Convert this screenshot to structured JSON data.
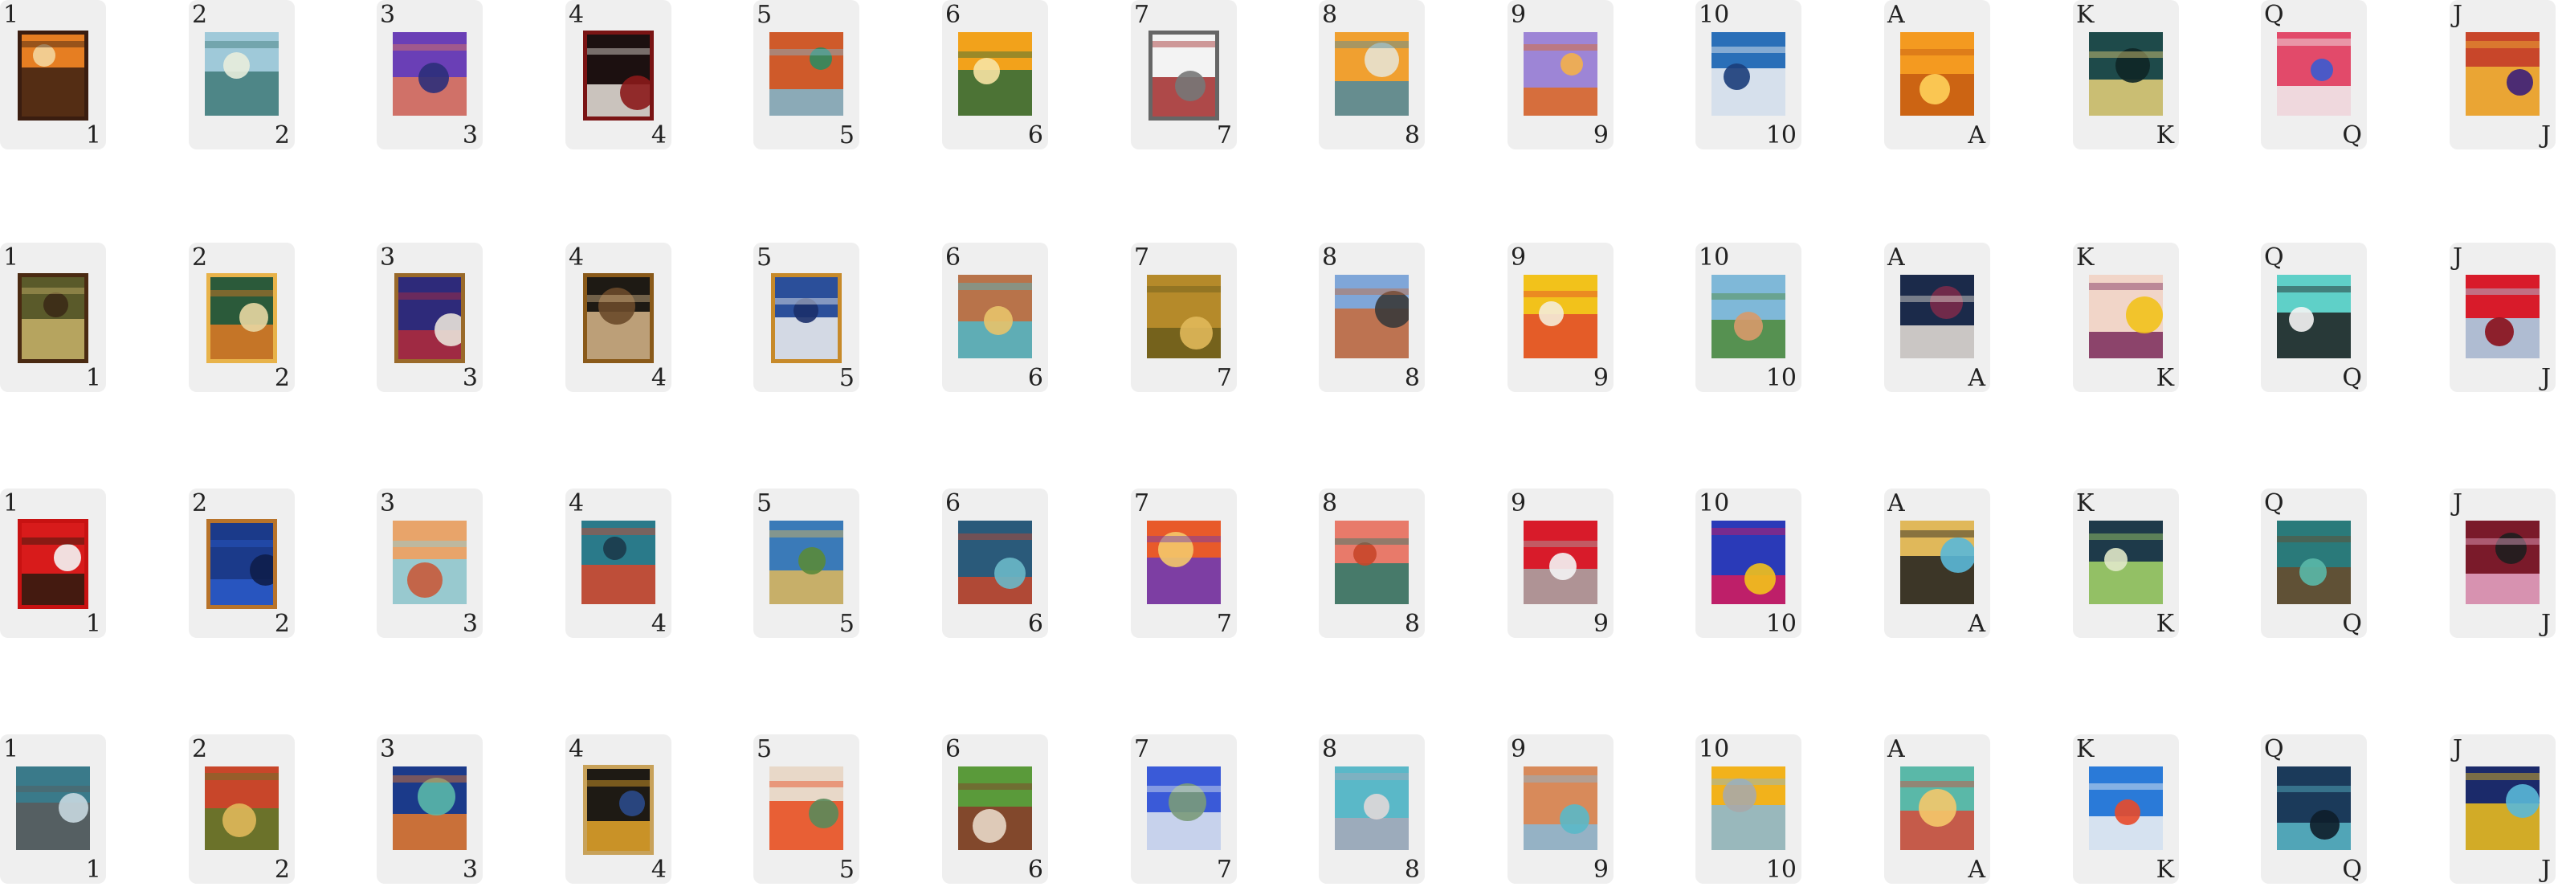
{
  "ranks": [
    "1",
    "2",
    "3",
    "4",
    "5",
    "6",
    "7",
    "8",
    "9",
    "10",
    "A",
    "K",
    "Q",
    "J"
  ],
  "rows": [
    {
      "cards": [
        {
          "art": "woman-portrait-art",
          "palette": [
            "#e67e22",
            "#3a1f12",
            "#f3d59c"
          ],
          "frame": "#3a1d10"
        },
        {
          "art": "coastal-landscape-art",
          "palette": [
            "#9fc9d9",
            "#3f7a78",
            "#e8eddc"
          ],
          "frame": ""
        },
        {
          "art": "reclining-figure-art",
          "palette": [
            "#6a3fb6",
            "#e27a5a",
            "#2c2f7a"
          ],
          "frame": ""
        },
        {
          "art": "ruffled-collar-portrait-art",
          "palette": [
            "#1c1010",
            "#e9e3dc",
            "#8b1a1a"
          ],
          "frame": "#7a1414"
        },
        {
          "art": "red-mesa-landscape-art",
          "palette": [
            "#cf5a2a",
            "#7fb8d0",
            "#2f8a5f"
          ],
          "frame": ""
        },
        {
          "art": "waterfall-poster-art",
          "palette": [
            "#f2a21b",
            "#2f6b3a",
            "#f7e3a3"
          ],
          "frame": ""
        },
        {
          "art": "city-sketch-art",
          "palette": [
            "#f3f3f3",
            "#a12a2a",
            "#777777"
          ],
          "frame": "#666666"
        },
        {
          "art": "canyon-cliffs-art",
          "palette": [
            "#f0a030",
            "#4e8aa0",
            "#e7e2d2"
          ],
          "frame": ""
        },
        {
          "art": "stone-arch-art",
          "palette": [
            "#9d85d6",
            "#e06a22",
            "#f4b04a"
          ],
          "frame": ""
        },
        {
          "art": "astronaut-wave-art",
          "palette": [
            "#2a6fb8",
            "#f4f4f4",
            "#1b3d7a"
          ],
          "frame": ""
        },
        {
          "art": "orange-sunset-art",
          "palette": [
            "#f49a20",
            "#c45a12",
            "#ffd05a"
          ],
          "frame": ""
        },
        {
          "art": "night-pond-art",
          "palette": [
            "#1e4a4a",
            "#e9d27a",
            "#0e2626"
          ],
          "frame": ""
        },
        {
          "art": "abstract-swirl-art",
          "palette": [
            "#e24a6a",
            "#f1f1f1",
            "#3b5bd0"
          ],
          "frame": ""
        },
        {
          "art": "desert-rock-art",
          "palette": [
            "#c8462a",
            "#f0b636",
            "#3b1f7a"
          ],
          "frame": ""
        }
      ]
    },
    {
      "cards": [
        {
          "art": "mushrooms-art",
          "palette": [
            "#5a5a2a",
            "#c7b268",
            "#3b2a16"
          ],
          "frame": "#4a2a12"
        },
        {
          "art": "green-bird-art",
          "palette": [
            "#2b5a3a",
            "#e07a24",
            "#e8d7a3"
          ],
          "frame": "#e8b34a"
        },
        {
          "art": "abstract-waves-art",
          "palette": [
            "#2e2a7a",
            "#b32a3a",
            "#e9e2d9"
          ],
          "frame": "#9a6a2a"
        },
        {
          "art": "dark-portrait-art",
          "palette": [
            "#1e1a14",
            "#d8b78a",
            "#6a4a2a"
          ],
          "frame": "#8a5a1a"
        },
        {
          "art": "clouds-sky-art",
          "palette": [
            "#2b4f9a",
            "#f1f1f1",
            "#1b2f6a"
          ],
          "frame": "#c78a2a"
        },
        {
          "art": "cliff-coast-art",
          "palette": [
            "#b8734a",
            "#4fb7c8",
            "#e8c36a"
          ],
          "frame": ""
        },
        {
          "art": "golden-field-art",
          "palette": [
            "#b58a2a",
            "#6a5a1a",
            "#e0b85a"
          ],
          "frame": ""
        },
        {
          "art": "modern-building-art",
          "palette": [
            "#7fa6d8",
            "#c86a3a",
            "#3a3a3a"
          ],
          "frame": ""
        },
        {
          "art": "sunflower-hand-art",
          "palette": [
            "#f2c21b",
            "#e24a2a",
            "#f4ecd8"
          ],
          "frame": ""
        },
        {
          "art": "cactus-desert-art",
          "palette": [
            "#7fb8d8",
            "#4f8a3a",
            "#d89a6a"
          ],
          "frame": ""
        },
        {
          "art": "bird-skull-art",
          "palette": [
            "#1b2a4a",
            "#e9e2d9",
            "#7a2a4a"
          ],
          "frame": ""
        },
        {
          "art": "bird-on-branch-art",
          "palette": [
            "#f1d5c8",
            "#7a2a5a",
            "#f2c21b"
          ],
          "frame": ""
        },
        {
          "art": "panda-art",
          "palette": [
            "#5fd0c8",
            "#1e1e1e",
            "#f4f4f4"
          ],
          "frame": ""
        },
        {
          "art": "red-flower-art",
          "palette": [
            "#d81b2a",
            "#a8d8f0",
            "#8a0e1a"
          ],
          "frame": ""
        }
      ]
    },
    {
      "cards": [
        {
          "art": "piano-cat-art",
          "palette": [
            "#d81b1b",
            "#2a1a0e",
            "#f4f4f4"
          ],
          "frame": "#c81212"
        },
        {
          "art": "blue-textile-art",
          "palette": [
            "#1b3a8a",
            "#2a5ac8",
            "#0e1e4a"
          ],
          "frame": "#b8732a"
        },
        {
          "art": "desert-ruins-art",
          "palette": [
            "#e8a46a",
            "#8ad0e0",
            "#c85a3a"
          ],
          "frame": ""
        },
        {
          "art": "octopus-art",
          "palette": [
            "#2a7a8a",
            "#d8462a",
            "#1b3a4a"
          ],
          "frame": ""
        },
        {
          "art": "hillside-village-art",
          "palette": [
            "#3a7ab8",
            "#e0b85a",
            "#5a8a3a"
          ],
          "frame": ""
        },
        {
          "art": "underwater-ruins-art",
          "palette": [
            "#2a5a7a",
            "#c8462a",
            "#6ab8c8"
          ],
          "frame": ""
        },
        {
          "art": "fish-sunset-art",
          "palette": [
            "#e85a2a",
            "#6a3ab8",
            "#f4c86a"
          ],
          "frame": ""
        },
        {
          "art": "pink-towers-art",
          "palette": [
            "#e87a6a",
            "#2a7a6a",
            "#c8462a"
          ],
          "frame": ""
        },
        {
          "art": "red-drop-eye-art",
          "palette": [
            "#d81b2a",
            "#a8a8a8",
            "#f4f4f4"
          ],
          "frame": ""
        },
        {
          "art": "spiral-flowers-art",
          "palette": [
            "#2a3ab8",
            "#d81b5a",
            "#f2c21b"
          ],
          "frame": ""
        },
        {
          "art": "raven-rain-art",
          "palette": [
            "#e0b85a",
            "#1e1e1e",
            "#5ab8d8"
          ],
          "frame": ""
        },
        {
          "art": "moon-islands-art",
          "palette": [
            "#1e3a4a",
            "#a8d86a",
            "#e0e8c8"
          ],
          "frame": ""
        },
        {
          "art": "underwater-log-art",
          "palette": [
            "#2a7a7a",
            "#6a4a2a",
            "#5ab8a8"
          ],
          "frame": ""
        },
        {
          "art": "maroon-pattern-art",
          "palette": [
            "#7a1a2a",
            "#e8a8c8",
            "#1e1e1e"
          ],
          "frame": ""
        }
      ]
    },
    {
      "cards": [
        {
          "art": "stormy-figure-art",
          "palette": [
            "#3a7a8a",
            "#5a5a5a",
            "#c8d8e0"
          ],
          "frame": ""
        },
        {
          "art": "red-door-art",
          "palette": [
            "#c8462a",
            "#5a7a2a",
            "#e0b85a"
          ],
          "frame": ""
        },
        {
          "art": "blue-cottage-art",
          "palette": [
            "#1b3a8a",
            "#e87a2a",
            "#5ab8a8"
          ],
          "frame": ""
        },
        {
          "art": "pearl-earring-art",
          "palette": [
            "#1e1a14",
            "#e8a82a",
            "#2a4a8a"
          ],
          "frame": "#c8a25a"
        },
        {
          "art": "fire-emblem-art",
          "palette": [
            "#e8d8c8",
            "#e84a1b",
            "#5a8a5a"
          ],
          "frame": ""
        },
        {
          "art": "frog-checker-art",
          "palette": [
            "#5a9a3a",
            "#8a3a2a",
            "#e8d8c8"
          ],
          "frame": ""
        },
        {
          "art": "blue-blossom-art",
          "palette": [
            "#3a5ad8",
            "#e0e8f0",
            "#7a9a7a"
          ],
          "frame": ""
        },
        {
          "art": "teal-birds-art",
          "palette": [
            "#5ab8c8",
            "#a8a8b8",
            "#e0d8d8"
          ],
          "frame": ""
        },
        {
          "art": "desert-river-art",
          "palette": [
            "#d88a5a",
            "#8ab8d8",
            "#5ab8c8"
          ],
          "frame": ""
        },
        {
          "art": "whale-sunflowers-art",
          "palette": [
            "#f2b21b",
            "#8ab8d8",
            "#a8a8a8"
          ],
          "frame": ""
        },
        {
          "art": "octopus-coral-art",
          "palette": [
            "#5ab8a8",
            "#d84a3a",
            "#f4c86a"
          ],
          "frame": ""
        },
        {
          "art": "boats-harbor-art",
          "palette": [
            "#2a7ad8",
            "#f4f4f4",
            "#e84a2a"
          ],
          "frame": ""
        },
        {
          "art": "fish-school-art",
          "palette": [
            "#1b3a5a",
            "#5ab8c8",
            "#0e1e2a"
          ],
          "frame": ""
        },
        {
          "art": "cosmic-fish-art",
          "palette": [
            "#1b2a6a",
            "#f2c21b",
            "#5ab8d8"
          ],
          "frame": ""
        }
      ]
    }
  ]
}
